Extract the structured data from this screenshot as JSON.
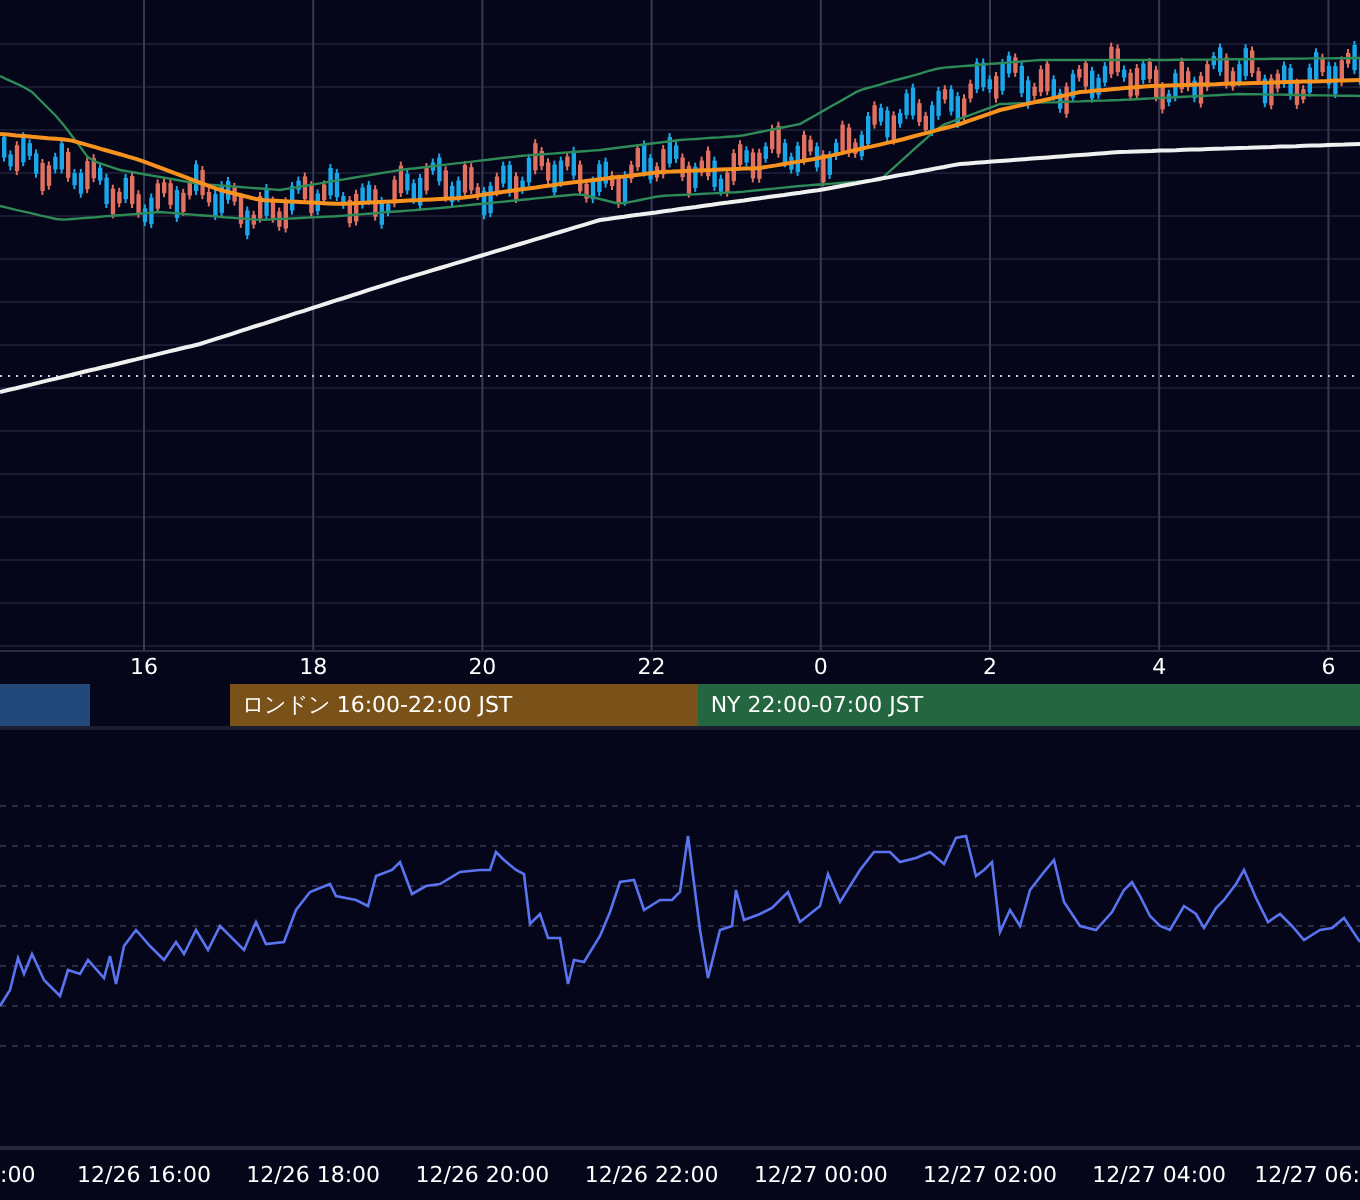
{
  "price_axis": {
    "labels": [
      "16",
      "18",
      "20",
      "22",
      "0",
      "2",
      "4",
      "6"
    ]
  },
  "sessions": [
    {
      "color": "#23497a"
    },
    {
      "label": "ロンドン 16:00-22:00 JST",
      "color": "#7a5118"
    },
    {
      "label": "NY 22:00-07:00 JST",
      "color": "#236640"
    }
  ],
  "time_axis": {
    "labels": [
      ":00",
      "12/26 16:00",
      "12/26 18:00",
      "12/26 20:00",
      "12/26 22:00",
      "12/27 00:00",
      "12/27 02:00",
      "12/27 04:00",
      "12/27 06:"
    ]
  }
}
